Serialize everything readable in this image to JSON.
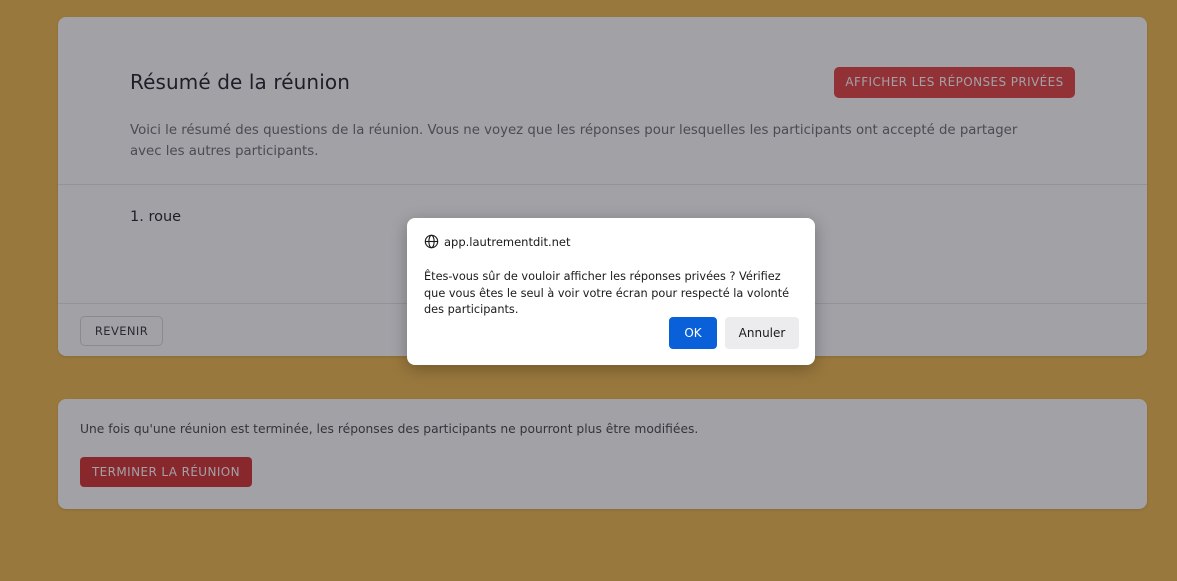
{
  "summary": {
    "title": "Résumé de la réunion",
    "show_private_label": "AFFICHER LES RÉPONSES PRIVÉES",
    "description": "Voici le résumé des questions de la réunion. Vous ne voyez que les réponses pour lesquelles les participants ont accepté de partager avec les autres participants.",
    "question_1": "1. roue",
    "back_label": "REVENIR"
  },
  "end_meeting": {
    "notice": "Une fois qu'une réunion est terminée, les réponses des participants ne pourront plus être modifiées.",
    "button_label": "TERMINER LA RÉUNION"
  },
  "dialog": {
    "origin": "app.lautrementdit.net",
    "icon": "globe-icon",
    "message": "Êtes-vous sûr de vouloir afficher les réponses privées ? Vérifiez que vous êtes le seul à voir votre écran pour respecté la volonté des participants.",
    "ok_label": "OK",
    "cancel_label": "Annuler"
  },
  "colors": {
    "background": "#f2b94a",
    "danger": "#e53e3e",
    "primary": "#0a60d8"
  }
}
